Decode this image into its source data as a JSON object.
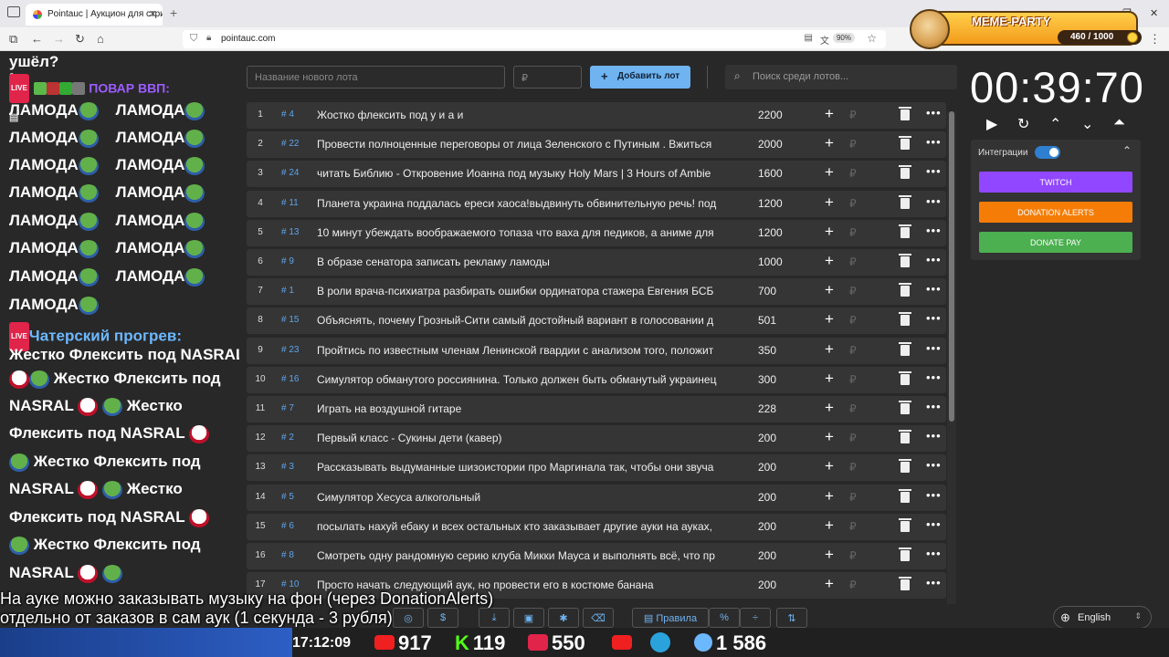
{
  "browser": {
    "tab_title": "Pointauc | Аукцион для стриме",
    "url": "pointauc.com",
    "zoom": "90%"
  },
  "overlay": {
    "title": "MEME-PARTY",
    "score": "460 / 1000"
  },
  "chat": {
    "lines": [
      {
        "text": "ушёл?"
      },
      {
        "nick": "ПОВАР ВВП:"
      },
      {
        "text": "ЛАМОДА",
        "text2": "ЛАМОДА"
      },
      {
        "text": "ЛАМОДА",
        "text2": "ЛАМОДА"
      },
      {
        "text": "ЛАМОДА",
        "text2": "ЛАМОДА"
      },
      {
        "text": "ЛАМОДА",
        "text2": "ЛАМОДА"
      },
      {
        "text": "ЛАМОДА",
        "text2": "ЛАМОДА"
      },
      {
        "text": "ЛАМОДА",
        "text2": "ЛАМОДА"
      },
      {
        "text": "ЛАМОДА",
        "text2": "ЛАМОДА"
      },
      {
        "text": "ЛАМОДА"
      },
      {
        "nick": "Чатерский прогрев:"
      },
      {
        "text": "Жестко Флексить под NASRAL"
      },
      {
        "text": "Жестко Флексить под"
      },
      {
        "text": "NASRAL",
        "text2": "Жестко"
      },
      {
        "text": "Флексить под NASRAL"
      },
      {
        "text": "Жестко Флексить под"
      },
      {
        "text": "NASRAL",
        "text2": "Жестко"
      },
      {
        "text": "Флексить под NASRAL"
      },
      {
        "text": "Жестко Флексить под"
      },
      {
        "text": "NASRAL"
      }
    ]
  },
  "controls": {
    "lot_name_placeholder": "Название нового лота",
    "amount_placeholder": "₽",
    "add_label": "Добавить лот",
    "search_placeholder": "Поиск среди лотов..."
  },
  "lots": [
    {
      "n": "1",
      "id": "# 4",
      "name": "Жостко флексить под у и а и",
      "amount": "2200"
    },
    {
      "n": "2",
      "id": "# 22",
      "name": "Провести полноценные переговоры от лица Зеленского с Путиным . Вжиться",
      "amount": "2000"
    },
    {
      "n": "3",
      "id": "# 24",
      "name": "читать Библию - Откровение Иоанна под музыку Holy Mars | 3 Hours of Ambie",
      "amount": "1600"
    },
    {
      "n": "4",
      "id": "# 11",
      "name": "Планета украина поддалась ереси хаоса!выдвинуть обвинительную речь! под",
      "amount": "1200"
    },
    {
      "n": "5",
      "id": "# 13",
      "name": "10 минут убеждать воображаемого топаза что ваха для педиков, а аниме для",
      "amount": "1200"
    },
    {
      "n": "6",
      "id": "# 9",
      "name": "В образе сенатора записать рекламу ламоды",
      "amount": "1000"
    },
    {
      "n": "7",
      "id": "# 1",
      "name": "В роли врача-психиатра разбирать ошибки ординатора стажера Евгения БСБ",
      "amount": "700"
    },
    {
      "n": "8",
      "id": "# 15",
      "name": "Объяснять, почему Грозный-Сити самый достойный вариант в голосовании д",
      "amount": "501"
    },
    {
      "n": "9",
      "id": "# 23",
      "name": "Пройтись по известным членам Ленинской гвардии с анализом того, положит",
      "amount": "350"
    },
    {
      "n": "10",
      "id": "# 16",
      "name": "Симулятор обманутого россиянина. Только должен быть обманутый украинец",
      "amount": "300"
    },
    {
      "n": "11",
      "id": "# 7",
      "name": "Играть на воздушной гитаре",
      "amount": "228"
    },
    {
      "n": "12",
      "id": "# 2",
      "name": "Первый класс - Сукины дети (кавер)",
      "amount": "200"
    },
    {
      "n": "13",
      "id": "# 3",
      "name": "Рассказывать выдуманные шизоистории про Маргинала так, чтобы они звуча",
      "amount": "200"
    },
    {
      "n": "14",
      "id": "# 5",
      "name": "Симулятор Хесуса алкогольный",
      "amount": "200"
    },
    {
      "n": "15",
      "id": "# 6",
      "name": "посылать нахуй ебаку и всех остальных кто заказывает другие ауки на ауках,",
      "amount": "200"
    },
    {
      "n": "16",
      "id": "# 8",
      "name": "Смотреть одну рандомную серию клуба Микки Мауса и выполнять всё, что пр",
      "amount": "200"
    },
    {
      "n": "17",
      "id": "# 10",
      "name": "Просто начать следующий аук, но провести его в костюме банана",
      "amount": "200"
    }
  ],
  "currency": "₽",
  "timer": {
    "value": "00:39:70"
  },
  "integrations": {
    "label": "Интеграции",
    "twitch": "TWITCH",
    "donation_alerts": "DONATION ALERTS",
    "donate_pay": "DONATE PAY",
    "colors": {
      "twitch": "#9147ff",
      "donation_alerts": "#f57d07",
      "donate_pay": "#4caf50"
    }
  },
  "bottom": {
    "rules_label": "Правила",
    "percent_label": "%",
    "language": "English"
  },
  "stream_overlay": {
    "text_line1": "На ауке можно заказывать музыку на фон (через DonationAlerts)",
    "text_line2": "отдельно от заказов в сам аук (1 секунда - 3 рубля)",
    "time": "17:12:09",
    "youtube": "917",
    "kick": "119",
    "vklive": "550",
    "viewers": "1 586"
  }
}
